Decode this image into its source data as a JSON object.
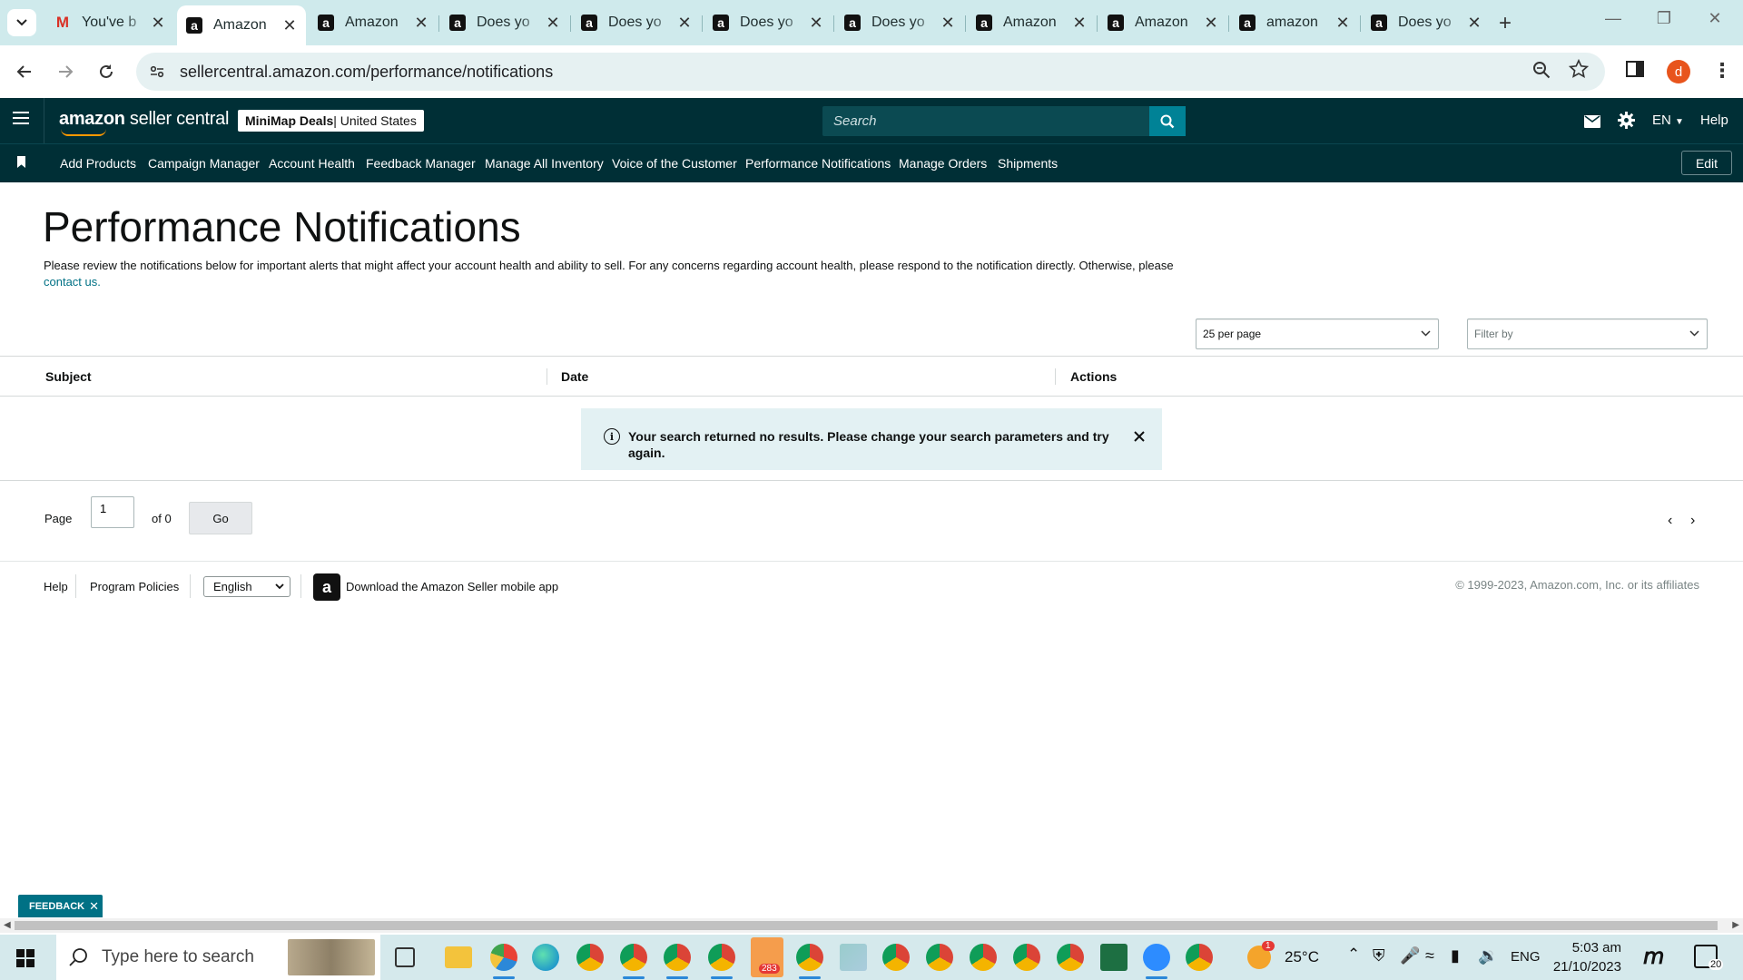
{
  "browser": {
    "tabs": [
      {
        "title": "You've b",
        "icon": "gmail-icon",
        "active": false
      },
      {
        "title": "Amazon",
        "icon": "amazon-icon",
        "active": true
      },
      {
        "title": "Amazon",
        "icon": "amazon-icon",
        "active": false
      },
      {
        "title": "Does yo",
        "icon": "amazon-icon",
        "active": false
      },
      {
        "title": "Does yo",
        "icon": "amazon-icon",
        "active": false
      },
      {
        "title": "Does yo",
        "icon": "amazon-icon",
        "active": false
      },
      {
        "title": "Does yo",
        "icon": "amazon-icon",
        "active": false
      },
      {
        "title": "Amazon",
        "icon": "amazon-icon",
        "active": false
      },
      {
        "title": "Amazon",
        "icon": "amazon-icon",
        "active": false
      },
      {
        "title": "amazon",
        "icon": "amazon-icon",
        "active": false
      },
      {
        "title": "Does yo",
        "icon": "amazon-icon",
        "active": false
      }
    ],
    "url": "sellercentral.amazon.com/performance/notifications",
    "profile_initial": "d"
  },
  "header": {
    "brand_bold": "amazon",
    "brand_rest": " seller central",
    "store_name": "MiniMap Deals",
    "store_region": " | United States",
    "search_placeholder": "Search",
    "language": "EN",
    "help": "Help"
  },
  "nav": {
    "items": [
      "Add Products",
      "Campaign Manager",
      "Account Health",
      "Feedback Manager",
      "Manage All Inventory",
      "Voice of the Customer",
      "Performance Notifications",
      "Manage Orders",
      "Shipments"
    ],
    "edit": "Edit"
  },
  "page": {
    "title": "Performance Notifications",
    "intro": "Please review the notifications below for important alerts that might affect your account health and ability to sell. For any concerns regarding account health, please respond to the notification directly. Otherwise, please ",
    "contact_link": "contact us.",
    "per_page": "25 per page",
    "filter_placeholder": "Filter by",
    "columns": [
      "Subject",
      "Date",
      "Actions"
    ],
    "alert_message": "Your search returned no results. Please change your search parameters and try again.",
    "pager": {
      "page_label": "Page",
      "page_value": "1",
      "of_label": "of 0",
      "go": "Go"
    }
  },
  "footer": {
    "help": "Help",
    "program_policies": "Program Policies",
    "language": "English",
    "app_text": "Download the Amazon Seller mobile app",
    "copyright": "© 1999-2023, Amazon.com, Inc. or its affiliates"
  },
  "feedback_tab": "FEEDBACK",
  "taskbar": {
    "search_placeholder": "Type here to search",
    "temperature": "25°C",
    "language": "ENG",
    "time": "5:03 am",
    "date": "21/10/2023",
    "telegram_badge": "283",
    "weather_badge": "1",
    "notifications_count": "20"
  },
  "colors": {
    "sc_header": "#002f36",
    "accent_teal": "#008296",
    "link": "#007185",
    "alert_bg": "#e3f1f3",
    "chrome_tabbar": "#cfeaec"
  }
}
